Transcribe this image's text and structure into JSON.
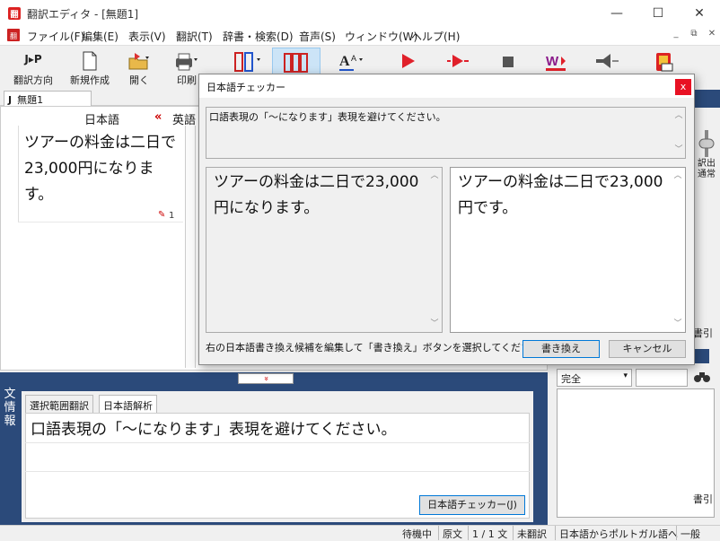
{
  "window": {
    "title": "翻訳エディタ - [無題1]",
    "minimize": "—",
    "maximize": "☐",
    "close": "✕"
  },
  "menu": {
    "items": [
      "ファイル(F)",
      "編集(E)",
      "表示(V)",
      "翻訳(T)",
      "辞書・検索(D)",
      "音声(S)",
      "ウィンドウ(W)",
      "ヘルプ(H)"
    ],
    "mdi_minimize": "_",
    "mdi_restore": "⧉",
    "mdi_close": "✕"
  },
  "toolbar": {
    "direction_label": "翻訳方向",
    "direction_icon_text": "J▸P",
    "new_label": "新規作成",
    "open_label": "開く",
    "print_label": "印刷"
  },
  "doc": {
    "tab_label": "無題1",
    "tab_prefix": "J",
    "lang_source": "日本語",
    "lang_arrow": "«",
    "lang_target": "英語",
    "source_text": "ツアーの料金は二日で23,000円になります。",
    "sentence_number": "1"
  },
  "right_panel": {
    "label_line1": "訳出",
    "label_line2": "通常",
    "dictionary_ref": "書引",
    "dictionary_ref2": "書引",
    "match_mode": "完全"
  },
  "bottom": {
    "collapse_arrow": "»",
    "side_label": "文情報",
    "tabs": [
      "選択範囲翻訳",
      "日本語解析"
    ],
    "analysis_text": "口語表現の「～になります」表現を避けてください。",
    "checker_button": "日本語チェッカー(J)"
  },
  "status": {
    "state": "待機中",
    "view": "原文",
    "sentence_count": "1 / 1 文",
    "translation_state": "未翻訳",
    "direction": "日本語からポルトガル語へ",
    "mode": "一般"
  },
  "dialog": {
    "title": "日本語チェッカー",
    "close": "x",
    "message": "口語表現の「～になります」表現を避けてください。",
    "original_text": "ツアーの料金は二日で23,000円になります。",
    "suggested_text": "ツアーの料金は二日で23,000円です。",
    "instruction": "右の日本語書き換え候補を編集して「書き換え」ボタンを選択してください。",
    "rewrite_button": "書き換え",
    "cancel_button": "キャンセル"
  },
  "colors": {
    "accent_blue": "#0078d7",
    "panel_dark_blue": "#2b4a7a",
    "close_red": "#e81123"
  }
}
